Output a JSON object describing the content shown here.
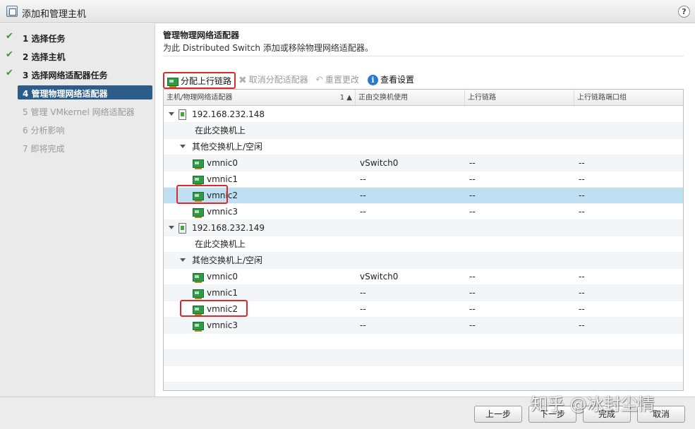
{
  "window": {
    "title": "添加和管理主机",
    "help_icon": "?"
  },
  "steps": [
    {
      "num": "1",
      "label": "选择任务",
      "state": "done"
    },
    {
      "num": "2",
      "label": "选择主机",
      "state": "done"
    },
    {
      "num": "3",
      "label": "选择网络适配器任务",
      "state": "done"
    },
    {
      "num": "4",
      "label": "管理物理网络适配器",
      "state": "current"
    },
    {
      "num": "5",
      "label": "管理 VMkernel 网络适配器",
      "state": "disabled"
    },
    {
      "num": "6",
      "label": "分析影响",
      "state": "disabled"
    },
    {
      "num": "7",
      "label": "即将完成",
      "state": "disabled"
    }
  ],
  "step_labels": {
    "s1": "1  选择任务",
    "s2": "2  选择主机",
    "s3": "3  选择网络适配器任务",
    "s4": "4 管理物理网络适配器",
    "s5": "5  管理 VMkernel 网络适配器",
    "s6": "6  分析影响",
    "s7": "7  即将完成"
  },
  "main": {
    "heading": "管理物理网络适配器",
    "subheading": "为此 Distributed Switch 添加或移除物理网络适配器。"
  },
  "toolbar": {
    "assign_uplink": "分配上行链路",
    "unassign_adapter": "取消分配适配器",
    "reset_changes": "重置更改",
    "view_settings": "查看设置"
  },
  "table": {
    "headers": [
      "主机/物理网络适配器",
      "正由交换机使用",
      "上行链路",
      "上行链路端口组"
    ],
    "sort_indicator": "1 ▲",
    "rows": [
      {
        "kind": "host",
        "name": "192.168.232.148",
        "switch": "",
        "uplink": "",
        "portgroup": ""
      },
      {
        "kind": "group",
        "name": "在此交换机上",
        "switch": "",
        "uplink": "",
        "portgroup": ""
      },
      {
        "kind": "group-open",
        "name": "其他交换机上/空闲",
        "switch": "",
        "uplink": "",
        "portgroup": ""
      },
      {
        "kind": "nic",
        "name": "vmnic0",
        "switch": "vSwitch0",
        "uplink": "--",
        "portgroup": "--"
      },
      {
        "kind": "nic",
        "name": "vmnic1",
        "switch": "--",
        "uplink": "--",
        "portgroup": "--"
      },
      {
        "kind": "nic",
        "name": "vmnic2",
        "switch": "--",
        "uplink": "--",
        "portgroup": "--",
        "selected": true
      },
      {
        "kind": "nic",
        "name": "vmnic3",
        "switch": "--",
        "uplink": "--",
        "portgroup": "--"
      },
      {
        "kind": "host",
        "name": "192.168.232.149",
        "switch": "",
        "uplink": "",
        "portgroup": ""
      },
      {
        "kind": "group",
        "name": "在此交换机上",
        "switch": "",
        "uplink": "",
        "portgroup": ""
      },
      {
        "kind": "group-open",
        "name": "其他交换机上/空闲",
        "switch": "",
        "uplink": "",
        "portgroup": ""
      },
      {
        "kind": "nic",
        "name": "vmnic0",
        "switch": "vSwitch0",
        "uplink": "--",
        "portgroup": "--"
      },
      {
        "kind": "nic",
        "name": "vmnic1",
        "switch": "--",
        "uplink": "--",
        "portgroup": "--"
      },
      {
        "kind": "nic",
        "name": "vmnic2",
        "switch": "--",
        "uplink": "--",
        "portgroup": "--"
      },
      {
        "kind": "nic",
        "name": "vmnic3",
        "switch": "--",
        "uplink": "--",
        "portgroup": "--"
      }
    ]
  },
  "footer": {
    "back": "上一步",
    "next": "下一步",
    "finish": "完成",
    "cancel": "取消"
  },
  "watermark": "知乎 @冰封尘情",
  "colors": {
    "selected_row": "#bfdff3",
    "current_step": "#2c5d8a",
    "highlight_box": "#d92b2b",
    "check": "#3a9a2a"
  }
}
